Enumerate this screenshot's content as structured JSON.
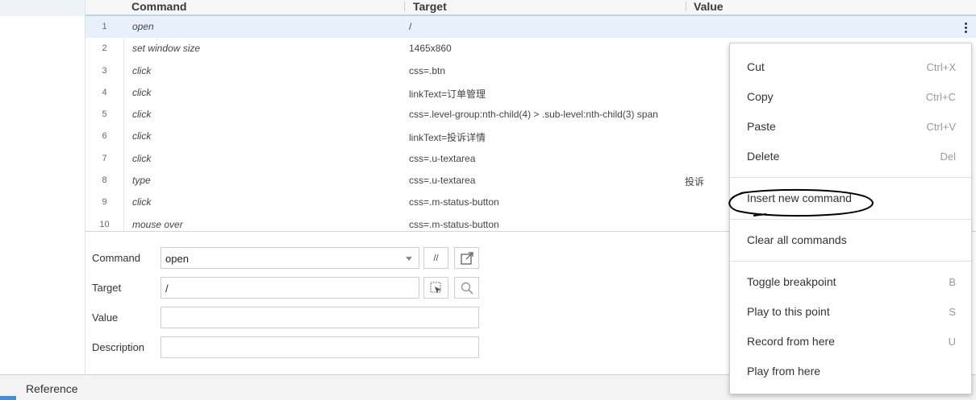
{
  "table": {
    "headers": {
      "command": "Command",
      "target": "Target",
      "value": "Value"
    },
    "rows": [
      {
        "num": "1",
        "command": "open",
        "target": "/",
        "value": ""
      },
      {
        "num": "2",
        "command": "set window size",
        "target": "1465x860",
        "value": ""
      },
      {
        "num": "3",
        "command": "click",
        "target": "css=.btn",
        "value": ""
      },
      {
        "num": "4",
        "command": "click",
        "target": "linkText=订单管理",
        "value": ""
      },
      {
        "num": "5",
        "command": "click",
        "target": "css=.level-group:nth-child(4) > .sub-level:nth-child(3) span",
        "value": ""
      },
      {
        "num": "6",
        "command": "click",
        "target": "linkText=投诉详情",
        "value": ""
      },
      {
        "num": "7",
        "command": "click",
        "target": "css=.u-textarea",
        "value": ""
      },
      {
        "num": "8",
        "command": "type",
        "target": "css=.u-textarea",
        "value": "投诉"
      },
      {
        "num": "9",
        "command": "click",
        "target": "css=.m-status-button",
        "value": ""
      },
      {
        "num": "10",
        "command": "mouse over",
        "target": "css=.m-status-button",
        "value": ""
      }
    ]
  },
  "editor": {
    "command_label": "Command",
    "command_value": "open",
    "target_label": "Target",
    "target_value": "/",
    "value_label": "Value",
    "value_value": "",
    "description_label": "Description",
    "description_value": "",
    "comment_button": "//"
  },
  "bottom": {
    "reference_tab": "Reference"
  },
  "context_menu": {
    "items": [
      {
        "label": "Cut",
        "shortcut": "Ctrl+X"
      },
      {
        "label": "Copy",
        "shortcut": "Ctrl+C"
      },
      {
        "label": "Paste",
        "shortcut": "Ctrl+V"
      },
      {
        "label": "Delete",
        "shortcut": "Del"
      },
      {
        "label": "Insert new command",
        "shortcut": ""
      },
      {
        "label": "Clear all commands",
        "shortcut": ""
      },
      {
        "label": "Toggle breakpoint",
        "shortcut": "B"
      },
      {
        "label": "Play to this point",
        "shortcut": "S"
      },
      {
        "label": "Record from here",
        "shortcut": "U"
      },
      {
        "label": "Play from here",
        "shortcut": ""
      }
    ]
  },
  "colors": {
    "selected_row": "#e8f0fb",
    "header_border": "#bcd3ec",
    "accent": "#4c8bd4",
    "annotation_ink": "#000000"
  }
}
